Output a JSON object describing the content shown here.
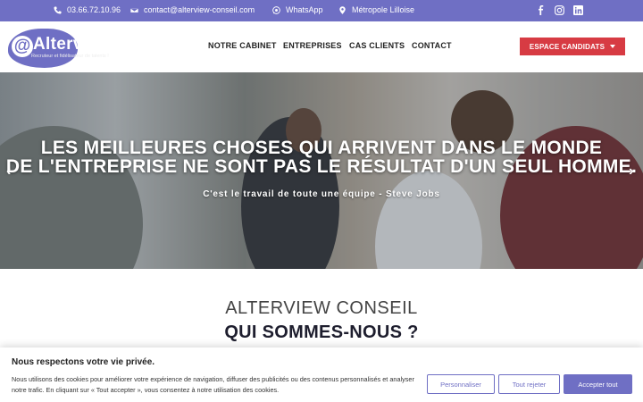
{
  "topbar": {
    "phone": "03.66.72.10.96",
    "email": "contact@alterview-conseil.com",
    "whatsapp": "WhatsApp",
    "location": "Métropole Lilloise",
    "social": [
      "facebook-icon",
      "instagram-icon",
      "linkedin-icon"
    ],
    "bg_color": "#6f6fc4"
  },
  "header": {
    "logo_at": "@",
    "logo_text": "Alterview",
    "logo_tagline": "Recruteur et fidélisateur de talents !",
    "nav": [
      "NOTRE CABINET",
      "ENTREPRISES",
      "CAS CLIENTS",
      "CONTACT"
    ],
    "cta_label": "ESPACE CANDIDATS",
    "cta_color": "#d73b43"
  },
  "hero": {
    "title_line1": "LES MEILLEURES CHOSES QUI ARRIVENT DANS LE MONDE",
    "title_line2": "DE L'ENTREPRISE NE SONT PAS LE RÉSULTAT D'UN SEUL HOMME.",
    "subtitle": "C'est le travail de toute une équipe - Steve Jobs",
    "prev_arrow": "‹",
    "next_arrow": "›"
  },
  "section": {
    "title1": "ALTERVIEW CONSEIL",
    "title2": "QUI SOMMES-NOUS ?"
  },
  "cookie": {
    "title": "Nous respectons votre vie privée.",
    "text": "Nous utilisons des cookies pour améliorer votre expérience de navigation, diffuser des publicités ou des contenus personnalisés et analyser notre trafic. En cliquant sur « Tout accepter », vous consentez à notre utilisation des cookies.",
    "customize": "Personnaliser",
    "reject": "Tout rejeter",
    "accept": "Accepter tout"
  }
}
